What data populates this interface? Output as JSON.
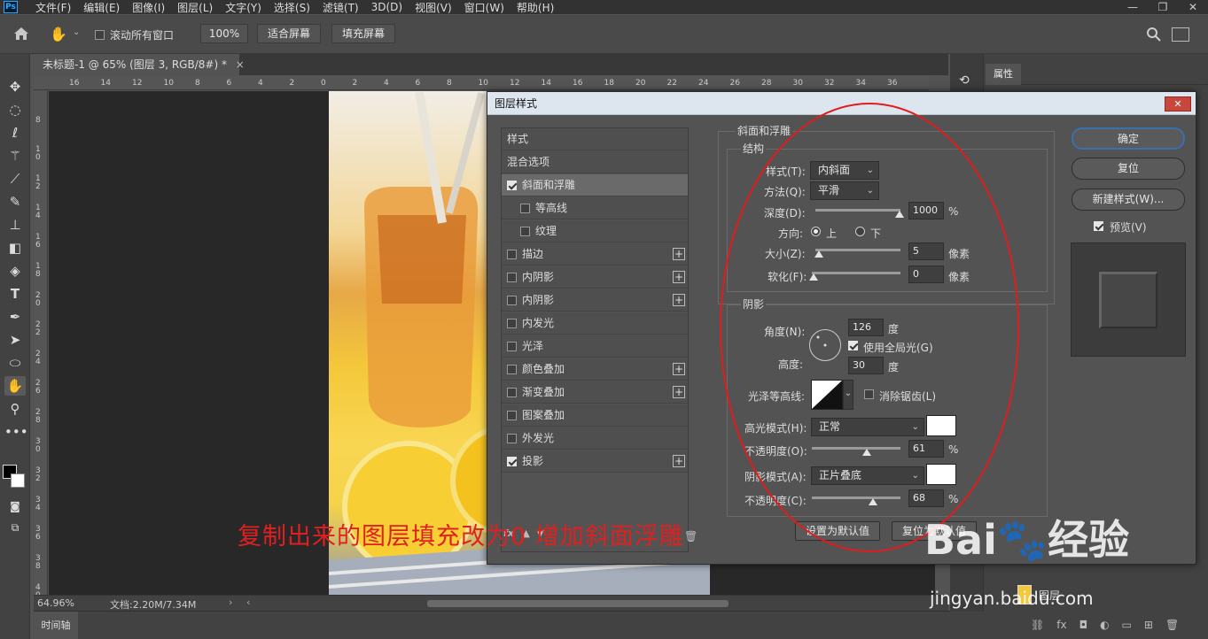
{
  "menubar": {
    "logo": "Ps",
    "items": [
      "文件(F)",
      "编辑(E)",
      "图像(I)",
      "图层(L)",
      "文字(Y)",
      "选择(S)",
      "滤镜(T)",
      "3D(D)",
      "视图(V)",
      "窗口(W)",
      "帮助(H)"
    ],
    "window_buttons": [
      "—",
      "❐",
      "✕"
    ]
  },
  "options": {
    "scroll_all_label": "滚动所有窗口",
    "zoom_value": "100%",
    "fit_screen": "适合屏幕",
    "fill_screen": "填充屏幕"
  },
  "document": {
    "tab_title": "未标题-1 @ 65% (图层 3, RGB/8#) *",
    "ruler_h": [
      "16",
      "14",
      "12",
      "10",
      "8",
      "6",
      "4",
      "2",
      "0",
      "2",
      "4",
      "6",
      "8",
      "10",
      "12",
      "14",
      "16",
      "18",
      "20",
      "22",
      "24",
      "26",
      "28",
      "30",
      "32",
      "34",
      "36"
    ],
    "ruler_v": [
      "8",
      "1\n0",
      "1\n2",
      "1\n4",
      "1\n6",
      "1\n8",
      "2\n0",
      "2\n2",
      "2\n4",
      "2\n6",
      "2\n8",
      "3\n0",
      "3\n2",
      "3\n4",
      "3\n6",
      "3\n8",
      "4\n0"
    ]
  },
  "status": {
    "zoom": "64.96%",
    "doc_info": "文档:2.20M/7.34M"
  },
  "timeline": {
    "label": "时间轴"
  },
  "right_panel": {
    "properties_tab": "属性",
    "layer_name": "图层"
  },
  "dialog": {
    "title": "图层样式",
    "styles": [
      {
        "label": "样式",
        "checkbox": false,
        "plus": false,
        "selected": false,
        "indent": false,
        "has_cb": false
      },
      {
        "label": "混合选项",
        "checkbox": false,
        "plus": false,
        "selected": false,
        "indent": false,
        "has_cb": false
      },
      {
        "label": "斜面和浮雕",
        "checkbox": true,
        "plus": false,
        "selected": true,
        "indent": false,
        "has_cb": true
      },
      {
        "label": "等高线",
        "checkbox": false,
        "plus": false,
        "selected": false,
        "indent": true,
        "has_cb": true
      },
      {
        "label": "纹理",
        "checkbox": false,
        "plus": false,
        "selected": false,
        "indent": true,
        "has_cb": true
      },
      {
        "label": "描边",
        "checkbox": false,
        "plus": true,
        "selected": false,
        "indent": false,
        "has_cb": true
      },
      {
        "label": "内阴影",
        "checkbox": false,
        "plus": true,
        "selected": false,
        "indent": false,
        "has_cb": true
      },
      {
        "label": "内阴影",
        "checkbox": false,
        "plus": true,
        "selected": false,
        "indent": false,
        "has_cb": true
      },
      {
        "label": "内发光",
        "checkbox": false,
        "plus": false,
        "selected": false,
        "indent": false,
        "has_cb": true
      },
      {
        "label": "光泽",
        "checkbox": false,
        "plus": false,
        "selected": false,
        "indent": false,
        "has_cb": true
      },
      {
        "label": "颜色叠加",
        "checkbox": false,
        "plus": true,
        "selected": false,
        "indent": false,
        "has_cb": true
      },
      {
        "label": "渐变叠加",
        "checkbox": false,
        "plus": true,
        "selected": false,
        "indent": false,
        "has_cb": true
      },
      {
        "label": "图案叠加",
        "checkbox": false,
        "plus": false,
        "selected": false,
        "indent": false,
        "has_cb": true
      },
      {
        "label": "外发光",
        "checkbox": false,
        "plus": false,
        "selected": false,
        "indent": false,
        "has_cb": true
      },
      {
        "label": "投影",
        "checkbox": true,
        "plus": true,
        "selected": false,
        "indent": false,
        "has_cb": true
      }
    ],
    "fx_label": "fx",
    "bevel": {
      "section_title": "斜面和浮雕",
      "structure_title": "结构",
      "style_label": "样式(T):",
      "style_value": "内斜面",
      "technique_label": "方法(Q):",
      "technique_value": "平滑",
      "depth_label": "深度(D):",
      "depth_value": "1000",
      "depth_unit": "%",
      "depth_level": 1.0,
      "direction_label": "方向:",
      "direction_up": "上",
      "direction_down": "下",
      "size_label": "大小(Z):",
      "size_value": "5",
      "size_unit": "像素",
      "size_level": 0.02,
      "soften_label": "软化(F):",
      "soften_value": "0",
      "soften_unit": "像素",
      "soften_level": 0.0
    },
    "shading": {
      "title": "阴影",
      "angle_label": "角度(N):",
      "angle_value": "126",
      "angle_unit": "度",
      "global_light_label": "使用全局光(G)",
      "altitude_label": "高度:",
      "altitude_value": "30",
      "altitude_unit": "度",
      "gloss_label": "光泽等高线:",
      "antialias_label": "消除锯齿(L)",
      "highlight_label": "高光模式(H):",
      "highlight_value": "正常",
      "highlight_opacity_label": "不透明度(O):",
      "highlight_opacity": "61",
      "highlight_opacity_level": 0.61,
      "shadow_label": "阴影模式(A):",
      "shadow_value": "正片叠底",
      "shadow_opacity_label": "不透明度(C):",
      "shadow_opacity": "68",
      "shadow_opacity_level": 0.68,
      "percent": "%"
    },
    "make_default": "设置为默认值",
    "reset_default": "复位为默认值",
    "ok": "确定",
    "reset": "复位",
    "new_style": "新建样式(W)...",
    "preview_label": "预览(V)"
  },
  "annotation": "复制出来的图层填充改为0 增加斜面浮雕",
  "watermark": {
    "line1": "Bai🐾经验",
    "line2": "jingyan.baidu.com"
  }
}
